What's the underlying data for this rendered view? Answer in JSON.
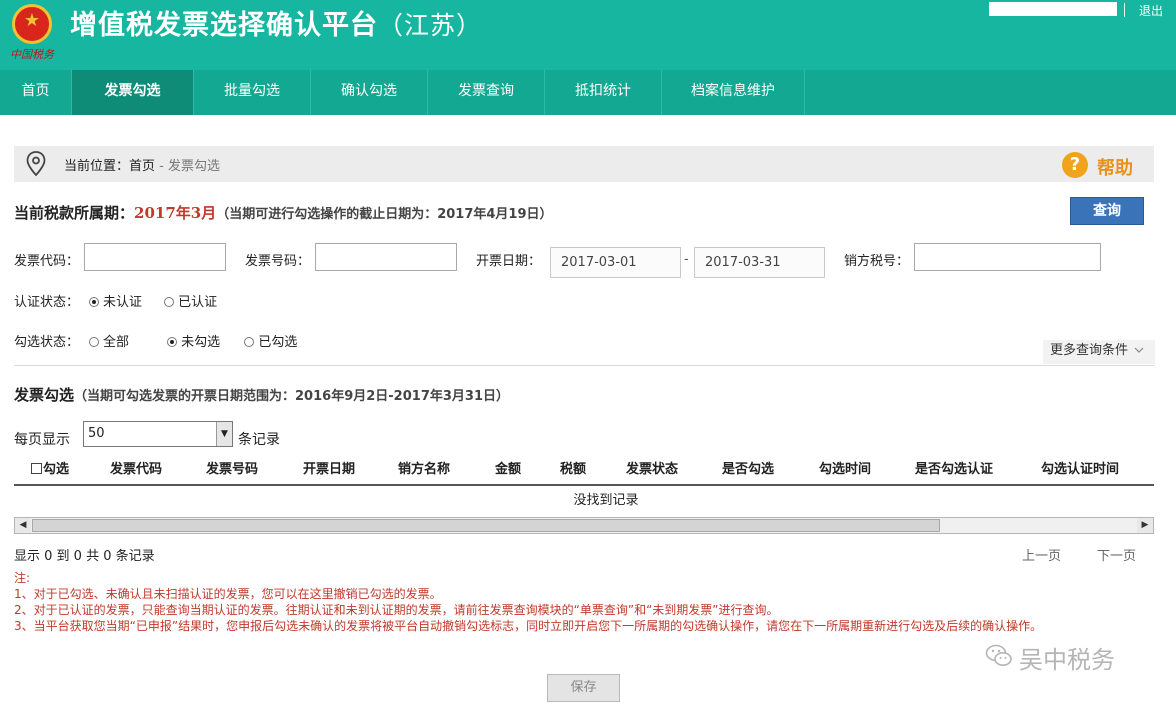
{
  "header": {
    "emblem_text": "中国税务",
    "title": "增值税发票选择确认平台",
    "province": "（江苏）",
    "logout": "退出",
    "bg_color": "#17b6a0"
  },
  "nav": {
    "items": [
      {
        "label": "首页",
        "active": false
      },
      {
        "label": "发票勾选",
        "active": true
      },
      {
        "label": "批量勾选",
        "active": false
      },
      {
        "label": "确认勾选",
        "active": false
      },
      {
        "label": "发票查询",
        "active": false
      },
      {
        "label": "抵扣统计",
        "active": false
      },
      {
        "label": "档案信息维护",
        "active": false
      }
    ]
  },
  "breadcrumb": {
    "prefix": "当前位置：",
    "home": "首页",
    "separator": " - ",
    "current": "发票勾选"
  },
  "help": {
    "icon": "?",
    "label": "帮助"
  },
  "period": {
    "label": "当前税款所属期：",
    "value": "2017年3月",
    "note": "（当期可进行勾选操作的截止日期为：2017年4月19日）"
  },
  "query_button": "查询",
  "filters": {
    "invoice_code_label": "发票代码：",
    "invoice_code_value": "",
    "invoice_number_label": "发票号码：",
    "invoice_number_value": "",
    "issue_date_label": "开票日期：",
    "date_from": "2017-03-01",
    "date_sep": "-",
    "date_to": "2017-03-31",
    "seller_tax_label": "销方税号：",
    "seller_tax_value": "",
    "cert_status_label": "认证状态：",
    "cert_options": [
      {
        "label": "未认证",
        "checked": true
      },
      {
        "label": "已认证",
        "checked": false
      }
    ],
    "select_status_label": "勾选状态：",
    "select_options": [
      {
        "label": "全部",
        "checked": false
      },
      {
        "label": "未勾选",
        "checked": true
      },
      {
        "label": "已勾选",
        "checked": false
      }
    ],
    "more_conditions": "更多查询条件",
    "more_icon": "chevron-down-icon"
  },
  "section": {
    "title": "发票勾选",
    "note": "（当期可勾选发票的开票日期范围为：2016年9月2日-2017年3月31日）"
  },
  "pagesize": {
    "prefix": "每页显示",
    "value": "50",
    "suffix": "条记录"
  },
  "table": {
    "columns": [
      "勾选",
      "发票代码",
      "发票号码",
      "开票日期",
      "销方名称",
      "金额",
      "税额",
      "发票状态",
      "是否勾选",
      "勾选时间",
      "是否勾选认证",
      "勾选认证时间"
    ],
    "rows": [],
    "empty_text": "没找到记录"
  },
  "summary": "显示 0 到 0 共 0 条记录",
  "pager": {
    "prev": "上一页",
    "next": "下一页"
  },
  "notes": {
    "title": "注:",
    "lines": [
      "1、对于已勾选、未确认且未扫描认证的发票，您可以在这里撤销已勾选的发票。",
      "2、对于已认证的发票，只能查询当期认证的发票。往期认证和未到认证期的发票，请前往发票查询模块的“单票查询”和“未到期发票”进行查询。",
      "3、当平台获取您当期“已申报”结果时，您申报后勾选未确认的发票将被平台自动撤销勾选标志，同时立即开启您下一所属期的勾选确认操作，请您在下一所属期重新进行勾选及后续的确认操作。"
    ]
  },
  "save_button": "保存",
  "watermark": "吴中税务"
}
